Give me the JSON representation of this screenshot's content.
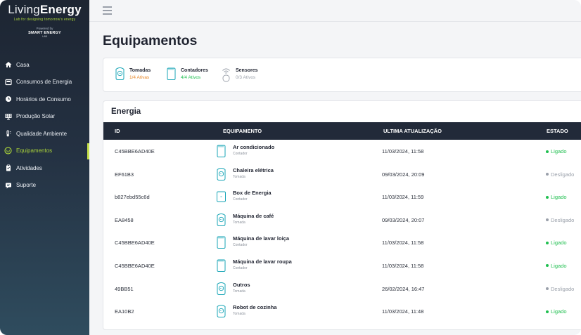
{
  "brand": {
    "name_light": "Living",
    "name_bold": "Energy",
    "tagline": "Lab for designing tomorrow's energy",
    "powered_by": "Powered by",
    "powered_brand": "SMART ENERGY",
    "powered_sub": "LAB"
  },
  "sidebar": {
    "items": [
      {
        "label": "Casa",
        "icon": "home-icon",
        "active": false
      },
      {
        "label": "Consumos de Energia",
        "icon": "meter-icon",
        "active": false
      },
      {
        "label": "Horários de Consumo",
        "icon": "clock-icon",
        "active": false
      },
      {
        "label": "Produção Solar",
        "icon": "solar-panel-icon",
        "active": false
      },
      {
        "label": "Qualidade Ambiente",
        "icon": "thermometer-icon",
        "active": false
      },
      {
        "label": "Equipamentos",
        "icon": "plug-icon",
        "active": true
      },
      {
        "label": "Atividades",
        "icon": "clipboard-icon",
        "active": false
      },
      {
        "label": "Suporte",
        "icon": "support-icon",
        "active": false
      }
    ]
  },
  "page": {
    "title": "Equipamentos"
  },
  "summary": [
    {
      "title": "Tomadas",
      "sub": "1/4 Ativas",
      "icon": "socket-icon",
      "color": "#e8892b"
    },
    {
      "title": "Contadores",
      "sub": "4/4 Ativos",
      "icon": "counter-icon",
      "color": "#1fbf4f"
    },
    {
      "title": "Sensores",
      "sub": "0/3 Ativos",
      "icon": "sensor-icon",
      "color": "#9aa0aa"
    }
  ],
  "energy": {
    "title": "Energia",
    "columns": {
      "id": "ID",
      "equipment": "EQUIPAMENTO",
      "updated": "ULTIMA ATUALIZAÇÃO",
      "state": "ESTADO"
    },
    "rows": [
      {
        "id": "C45BBE6AD40E",
        "name": "Ar condicionado",
        "type": "Contador",
        "icon": "counter-icon",
        "date": "11/03/2024, 11:58",
        "state": "Ligado",
        "on": true
      },
      {
        "id": "EF61B3",
        "name": "Chaleira elétrica",
        "type": "Tomada",
        "icon": "socket-icon",
        "date": "09/03/2024, 20:09",
        "state": "Desligado",
        "on": false
      },
      {
        "id": "b827ebd55c6d",
        "name": "Box de Energia",
        "type": "Contador",
        "icon": "box-icon",
        "date": "11/03/2024, 11:59",
        "state": "Ligado",
        "on": true
      },
      {
        "id": "EA8458",
        "name": "Máquina de café",
        "type": "Tomada",
        "icon": "socket-icon",
        "date": "09/03/2024, 20:07",
        "state": "Desligado",
        "on": false
      },
      {
        "id": "C45BBE6AD40E",
        "name": "Máquina de lavar loiça",
        "type": "Contador",
        "icon": "counter-icon",
        "date": "11/03/2024, 11:58",
        "state": "Ligado",
        "on": true
      },
      {
        "id": "C45BBE6AD40E",
        "name": "Máquina de lavar roupa",
        "type": "Contador",
        "icon": "counter-icon",
        "date": "11/03/2024, 11:58",
        "state": "Ligado",
        "on": true
      },
      {
        "id": "49BB51",
        "name": "Outros",
        "type": "Tomada",
        "icon": "socket-icon",
        "date": "26/02/2024, 16:47",
        "state": "Desligado",
        "on": false
      },
      {
        "id": "EA10B2",
        "name": "Robot de cozinha",
        "type": "Tomada",
        "icon": "socket-icon",
        "date": "11/03/2024, 11:48",
        "state": "Ligado",
        "on": true
      }
    ]
  },
  "colors": {
    "accent": "#a9d23a",
    "on": "#1fbf4f",
    "off": "#9aa0aa",
    "icon_stroke": "#1aa6b7"
  }
}
